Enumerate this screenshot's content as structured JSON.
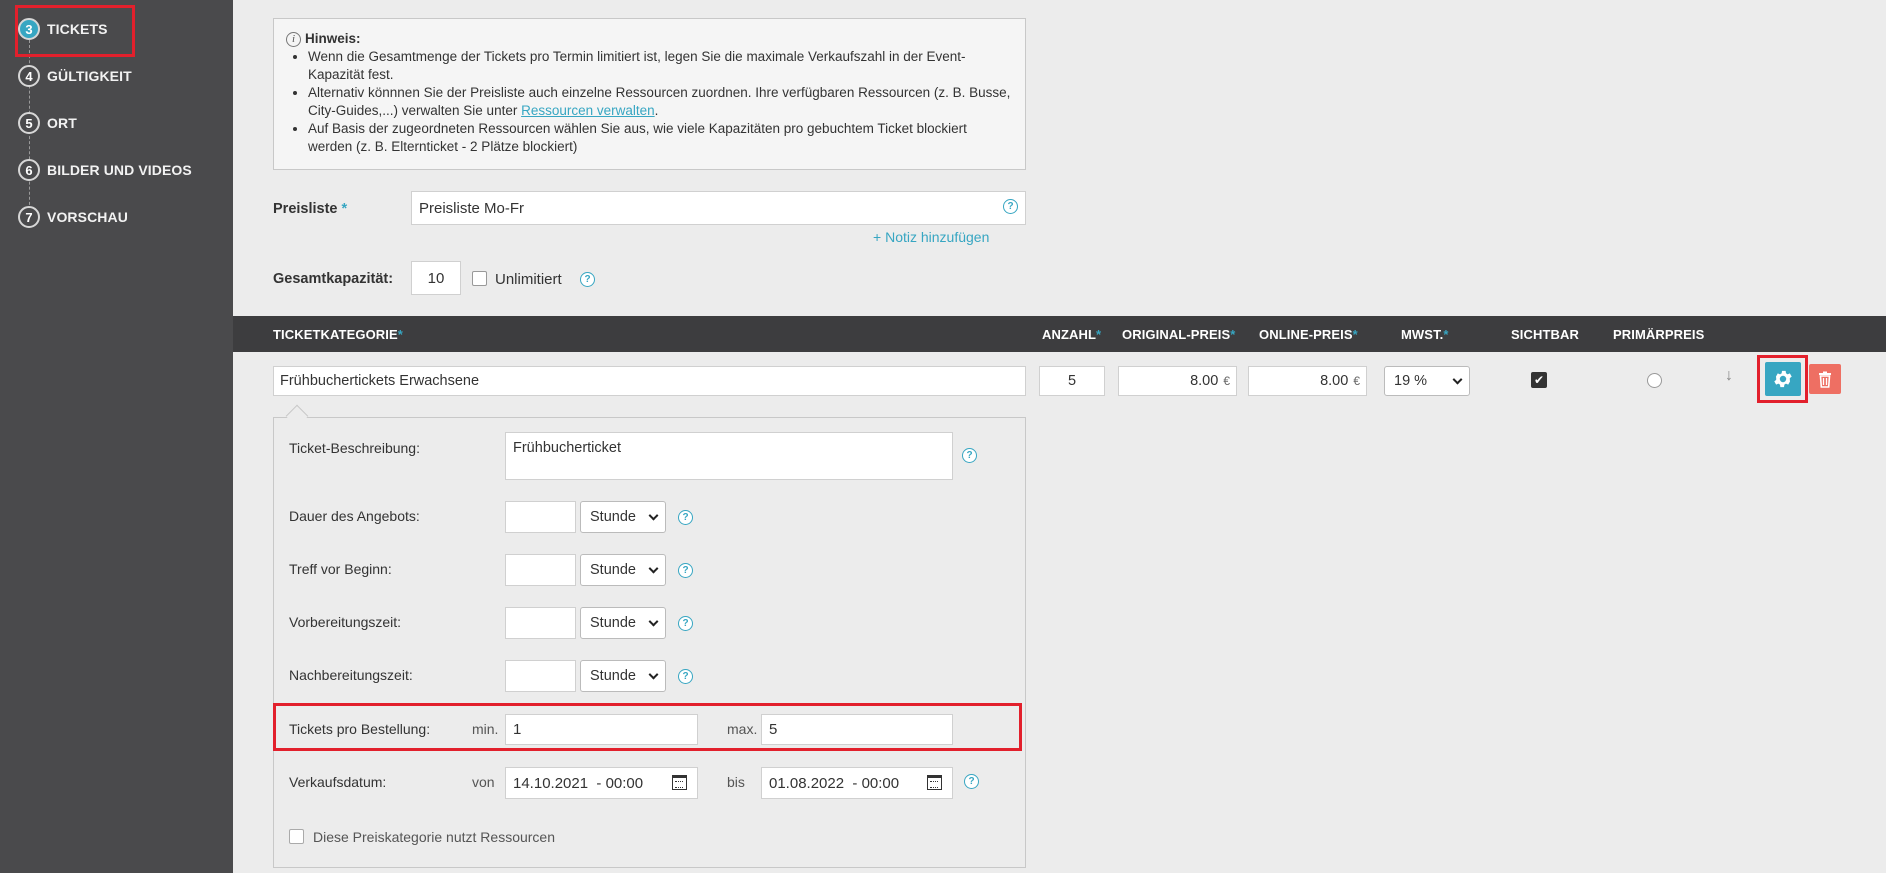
{
  "sidebar": {
    "steps": [
      {
        "num": "3",
        "label": "TICKETS",
        "active": true
      },
      {
        "num": "4",
        "label": "GÜLTIGKEIT"
      },
      {
        "num": "5",
        "label": "ORT"
      },
      {
        "num": "6",
        "label": "BILDER UND VIDEOS"
      },
      {
        "num": "7",
        "label": "VORSCHAU"
      }
    ]
  },
  "hint": {
    "title": "Hinweis:",
    "items": [
      "Wenn die Gesamtmenge der Tickets pro Termin limitiert ist, legen Sie die maximale Verkaufszahl in der Event-Kapazität fest.",
      "Alternativ könnnen Sie der Preisliste auch einzelne Ressourcen zuordnen. Ihre verfügbaren Ressourcen (z. B. Busse, City-Guides,...) verwalten Sie unter ",
      "Auf Basis der zugeordneten Ressourcen wählen Sie aus, wie viele Kapazitäten pro gebuchtem Ticket blockiert werden (z. B. Elternticket - 2 Plätze blockiert)"
    ],
    "link": "Ressourcen verwalten",
    "link_suffix": "."
  },
  "form": {
    "pricelist_label": "Preisliste",
    "pricelist_value": "Preisliste Mo-Fr",
    "note_link": "Notiz hinzufügen",
    "capacity_label": "Gesamtkapazität:",
    "capacity_value": "10",
    "unlimited_label": "Unlimitiert"
  },
  "table": {
    "headers": {
      "category": "TICKETKATEGORIE",
      "count": "ANZAHL",
      "original_price": "ORIGINAL-PREIS",
      "online_price": "ONLINE-PREIS",
      "vat": "MWST.",
      "visible": "SICHTBAR",
      "primary": "PRIMÄRPREIS"
    },
    "row": {
      "category": "Frühbuchertickets Erwachsene",
      "count": "5",
      "original_price": "8.00",
      "online_price": "8.00",
      "currency": "€",
      "vat": "19 %",
      "visible": true
    }
  },
  "details": {
    "description_label": "Ticket-Beschreibung:",
    "description_value": "Frühbucherticket",
    "duration_label": "Dauer des Angebots:",
    "meet_label": "Treff vor Beginn:",
    "prep_label": "Vorbereitungszeit:",
    "post_label": "Nachbereitungszeit:",
    "unit": "Stunde",
    "per_order_label": "Tickets pro Bestellung:",
    "min_label": "min.",
    "min_value": "1",
    "max_label": "max.",
    "max_value": "5",
    "sale_label": "Verkaufsdatum:",
    "from_label": "von",
    "from_value": "14.10.2021  - 00:00",
    "to_label": "bis",
    "to_value": "01.08.2022  - 00:00",
    "resources_label": "Diese Preiskategorie nutzt Ressourcen"
  },
  "colors": {
    "accent": "#37a6c2",
    "highlight": "#e2202c",
    "delete": "#ee6f63",
    "sidebar": "#4a4a4c",
    "table_header": "#3d3d3f"
  }
}
